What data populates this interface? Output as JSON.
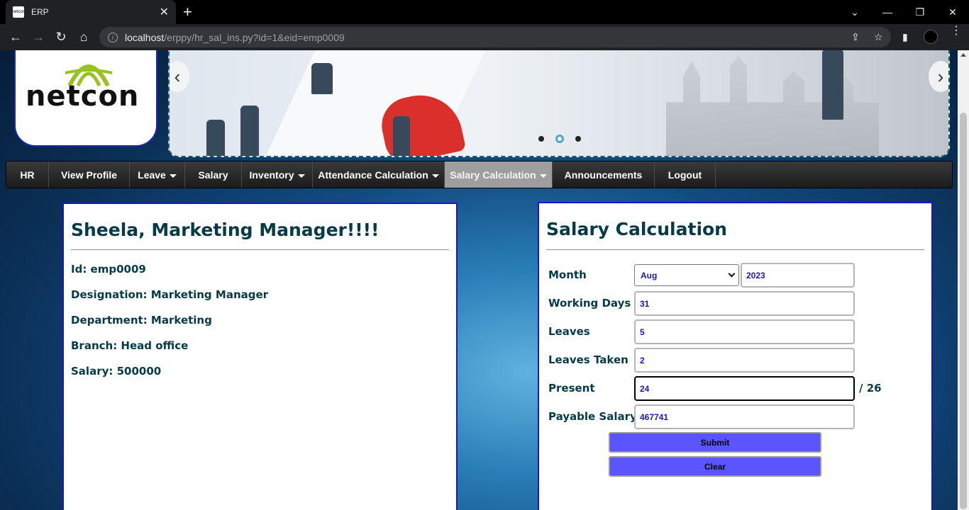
{
  "browser": {
    "tab_title": "ERP",
    "favicon_text": "netcon",
    "url_host": "localhost",
    "url_path": "/erppy/hr_sal_ins.py?id=1&eid=emp0009"
  },
  "logo": {
    "text": "netcon"
  },
  "menu": {
    "items": [
      {
        "label": "HR",
        "dropdown": false
      },
      {
        "label": "View Profile",
        "dropdown": false
      },
      {
        "label": "Leave",
        "dropdown": true
      },
      {
        "label": "Salary",
        "dropdown": false
      },
      {
        "label": "Inventory",
        "dropdown": true
      },
      {
        "label": "Attendance Calculation",
        "dropdown": true
      },
      {
        "label": "Salary Calculation",
        "dropdown": true,
        "active": true
      },
      {
        "label": "Announcements",
        "dropdown": false
      },
      {
        "label": "Logout",
        "dropdown": false
      }
    ]
  },
  "profile": {
    "heading": "Sheela, Marketing Manager!!!!",
    "id": "Id: emp0009",
    "designation": "Designation: Marketing Manager",
    "department": "Department: Marketing",
    "branch": "Branch: Head office",
    "salary": "Salary: 500000"
  },
  "salary_form": {
    "heading": "Salary Calculation",
    "month_label": "Month",
    "month_value": "Aug",
    "year_value": "2023",
    "working_days_label": "Working Days",
    "working_days_value": "31",
    "leaves_label": "Leaves",
    "leaves_value": "5",
    "leaves_taken_label": "Leaves Taken",
    "leaves_taken_value": "2",
    "present_label": "Present",
    "present_value": "24",
    "present_total": "/ 26",
    "payable_label": "Payable Salary",
    "payable_value": "467741",
    "submit_label": "Submit",
    "clear_label": "Clear"
  },
  "colors": {
    "panel_border": "#1a12d6",
    "heading_text": "#063a47",
    "button_bg": "#5a55ff",
    "menu_active": "#9e9e9e"
  }
}
